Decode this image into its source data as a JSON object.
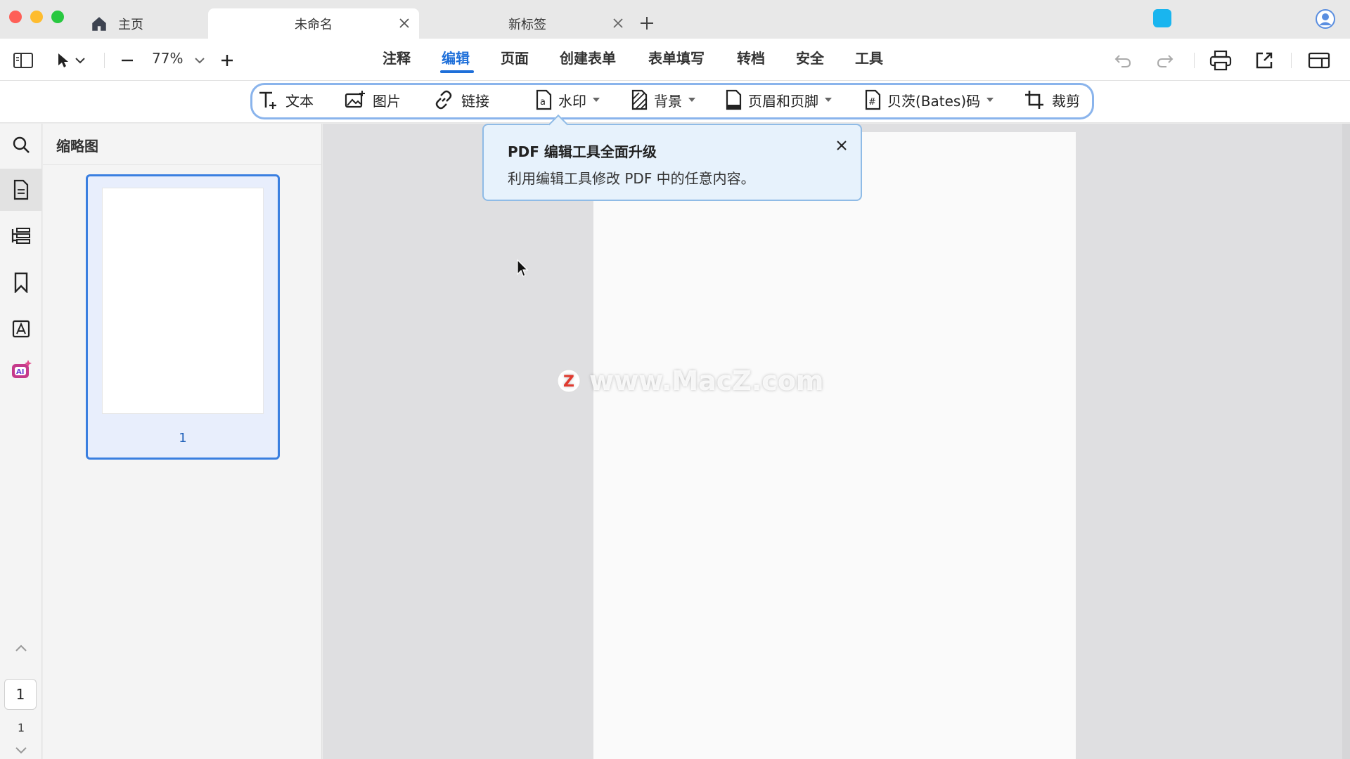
{
  "tabs": {
    "home_label": "主页",
    "active_label": "未命名",
    "new_label": "新标签"
  },
  "toolbar": {
    "zoom_level": "77%",
    "nav_tabs": [
      "注释",
      "编辑",
      "页面",
      "创建表单",
      "表单填写",
      "转档",
      "安全",
      "工具"
    ],
    "active_tab": "编辑"
  },
  "subtoolbar": {
    "items": [
      "文本",
      "图片",
      "链接",
      "水印",
      "背景",
      "页眉和页脚",
      "贝茨(Bates)码",
      "裁剪"
    ]
  },
  "sidebar": {
    "thumbnail_title": "缩略图",
    "thumbnail_page_number": "1",
    "current_page": "1",
    "total_pages": "1"
  },
  "popover": {
    "title": "PDF 编辑工具全面升级",
    "body": "利用编辑工具修改 PDF 中的任意内容。"
  },
  "watermark": {
    "text": "www.MacZ.com",
    "logo_letter": "Z"
  },
  "colors": {
    "accent": "#1e6fd9",
    "app_badge": "#19b5ef",
    "popover_bg": "#e7f2fc"
  }
}
